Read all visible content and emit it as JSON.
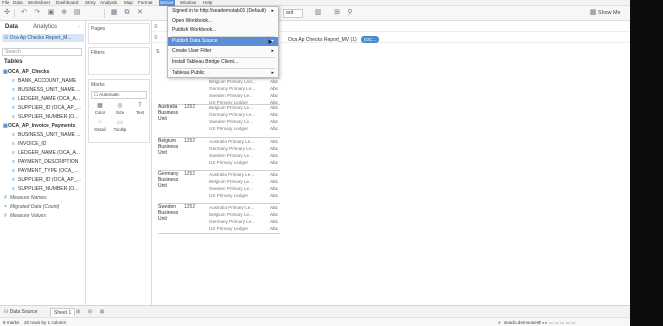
{
  "menubar": {
    "items": [
      "File",
      "Data",
      "Worksheet",
      "Dashboard",
      "Story",
      "Analysis",
      "Map",
      "Format",
      "Server",
      "Window",
      "Help"
    ],
    "active": "Server"
  },
  "toolbar": {
    "dashboard_dropdown": "ard",
    "show_me_label": "Show Me"
  },
  "datapane": {
    "tab_data": "Data",
    "tab_analytics": "Analytics",
    "datasource": "Oca Ap Checks Report_M...",
    "search_placeholder": "Search",
    "tables_title": "Tables",
    "groups": [
      {
        "name": "OCA_AP_Checks",
        "fields": [
          "BANK_ACCOUNT_NAME",
          "BUSINESS_UNIT_NAME ...",
          "LEDGER_NAME (OCA_A...",
          "SUPPLIER_ID (OCA_AP_...",
          "SUPPLIER_NUMBER (O..."
        ]
      },
      {
        "name": "OCA_AP_Invoice_Payments",
        "fields": [
          "BUSINESS_UNIT_NAME ...",
          "INVOICE_ID",
          "LEDGER_NAME (OCA_A...",
          "PAYMENT_DESCRIPTION",
          "PAYMENT_TYPE (OCA_...",
          "SUPPLIER_ID (OCA_AP_...",
          "SUPPLIER_NUMBER (O..."
        ]
      }
    ],
    "measures": [
      "Measure Names",
      "Migrated Data (Count)",
      "Measure Values"
    ]
  },
  "shelves": {
    "pages": "Pages",
    "filters": "Filters",
    "marks": "Marks",
    "marks_type": "Automatic",
    "mark_buttons": [
      "Color",
      "Size",
      "Text",
      "Detail",
      "Tooltip"
    ]
  },
  "sheet": {
    "columns_pill_left": "Oca Ap Checks Report_MV (1)",
    "columns_pill_right": "(OC...",
    "rows": [
      {
        "unit": "Australia Business Unit",
        "num": "1252",
        "ledgers": [
          "Belgium Primary Le...",
          "Germany Primary Le...",
          "Sweden Primary Le...",
          "US Primary Ledger"
        ]
      },
      {
        "unit": "Belgium Business Unit",
        "num": "1252",
        "ledgers": [
          "Australia Primary Le...",
          "Germany Primary Le...",
          "Sweden Primary Le...",
          "US Primary Ledger"
        ]
      },
      {
        "unit": "Germany Business Unit",
        "num": "1252",
        "ledgers": [
          "Australia Primary Le...",
          "Belgium Primary Le...",
          "Sweden Primary Le...",
          "US Primary Ledger"
        ]
      },
      {
        "unit": "Sweden Business Unit",
        "num": "1252",
        "ledgers": [
          "Australia Primary Le...",
          "Belgium Primary Le...",
          "Germany Primary Le...",
          "US Primary Ledger"
        ]
      }
    ],
    "top_ledgers": [
      "Belgium Primary Led...",
      "Germany Primary Le...",
      "Sweden Primary Le...",
      "US Primary Ledger"
    ],
    "abc": "Abc"
  },
  "server_menu": {
    "items": [
      {
        "label": "Signed in to http://seademotab01 (Default)",
        "submenu": true
      },
      {
        "label": "Open Workbook...",
        "submenu": false
      },
      {
        "label": "Publish Workbook...",
        "submenu": false
      },
      {
        "label": "Publish Data Source",
        "submenu": true,
        "highlighted": true
      },
      {
        "label": "Create User Filter",
        "submenu": true
      },
      {
        "label": "Install Tableau Bridge Client...",
        "submenu": false
      },
      {
        "label": "Tableau Public",
        "submenu": true
      }
    ]
  },
  "tabs": {
    "datasource": "Data Source",
    "sheet1": "Sheet 1"
  },
  "status": {
    "marks": "8 marks",
    "rows_cols": "20 rows by 1 column",
    "user": "seado.demouser2"
  },
  "colors": {
    "accent": "#5a8fd6",
    "pill": "#4a8bc9",
    "selected_row": "#d9e7f5"
  }
}
